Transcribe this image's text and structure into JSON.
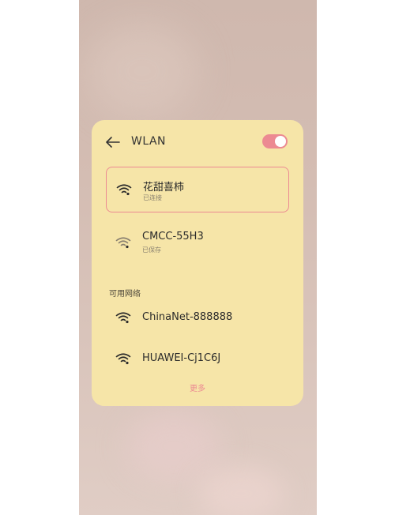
{
  "header": {
    "title": "WLAN",
    "wlan_enabled": true
  },
  "saved_networks": [
    {
      "name": "花甜喜柿",
      "status": "已连接",
      "connected": true
    },
    {
      "name": "CMCC-55H3",
      "status": "已保存",
      "connected": false
    }
  ],
  "available": {
    "section_label": "可用网络",
    "networks": [
      {
        "name": "ChinaNet-888888"
      },
      {
        "name": "HUAWEI-Cj1C6J"
      }
    ],
    "more_label": "更多"
  },
  "colors": {
    "card": "#f6e5a8",
    "accent": "#ec8a92",
    "text": "#2b2b2b",
    "background": "#d4bdb3"
  },
  "icons": {
    "back": "arrow-left-icon",
    "wifi": "wifi-icon",
    "toggle": "toggle-switch"
  }
}
